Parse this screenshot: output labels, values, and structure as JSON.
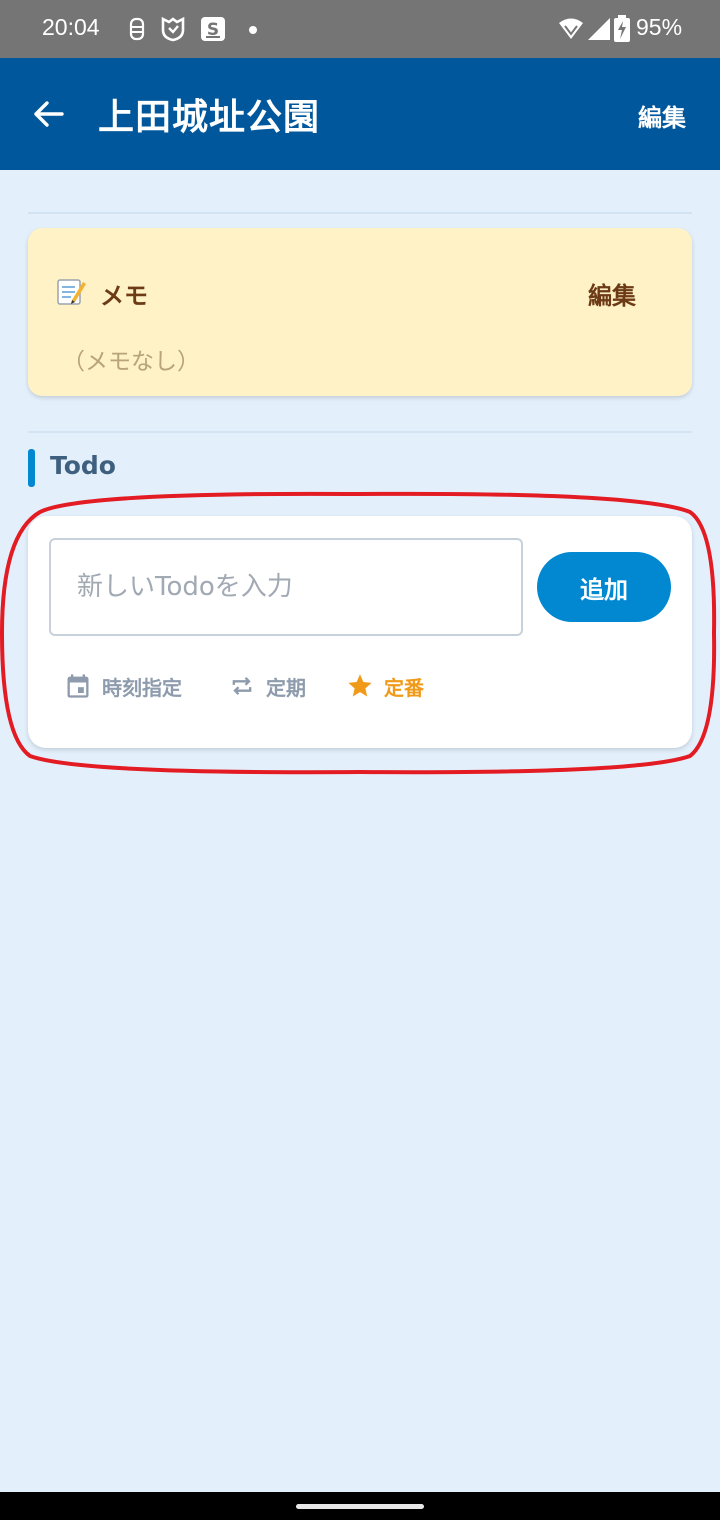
{
  "status_bar": {
    "time": "20:04",
    "battery_percent": "95%",
    "icons": [
      "face-icon",
      "shield-icon",
      "clipboard-icon",
      "notification-dot",
      "wifi-icon",
      "signal-icon",
      "battery-charging-icon"
    ]
  },
  "app_bar": {
    "title": "上田城址公園",
    "edit_label": "編集",
    "back_icon": "arrow-back-icon"
  },
  "memo": {
    "icon": "memo-emoji-icon",
    "title": "メモ",
    "edit_label": "編集",
    "empty_text": "（メモなし）"
  },
  "todo": {
    "heading": "Todo",
    "input_placeholder": "新しいTodoを入力",
    "input_value": "",
    "add_label": "追加",
    "options": {
      "time": "時刻指定",
      "repeat": "定期",
      "favorite": "定番"
    }
  },
  "colors": {
    "app_bar": "#01579b",
    "background": "#e3f0fc",
    "memo_card": "#fef2c6",
    "accent": "#0288d1",
    "favorite": "#f09a1a",
    "highlight": "#e31b23"
  }
}
